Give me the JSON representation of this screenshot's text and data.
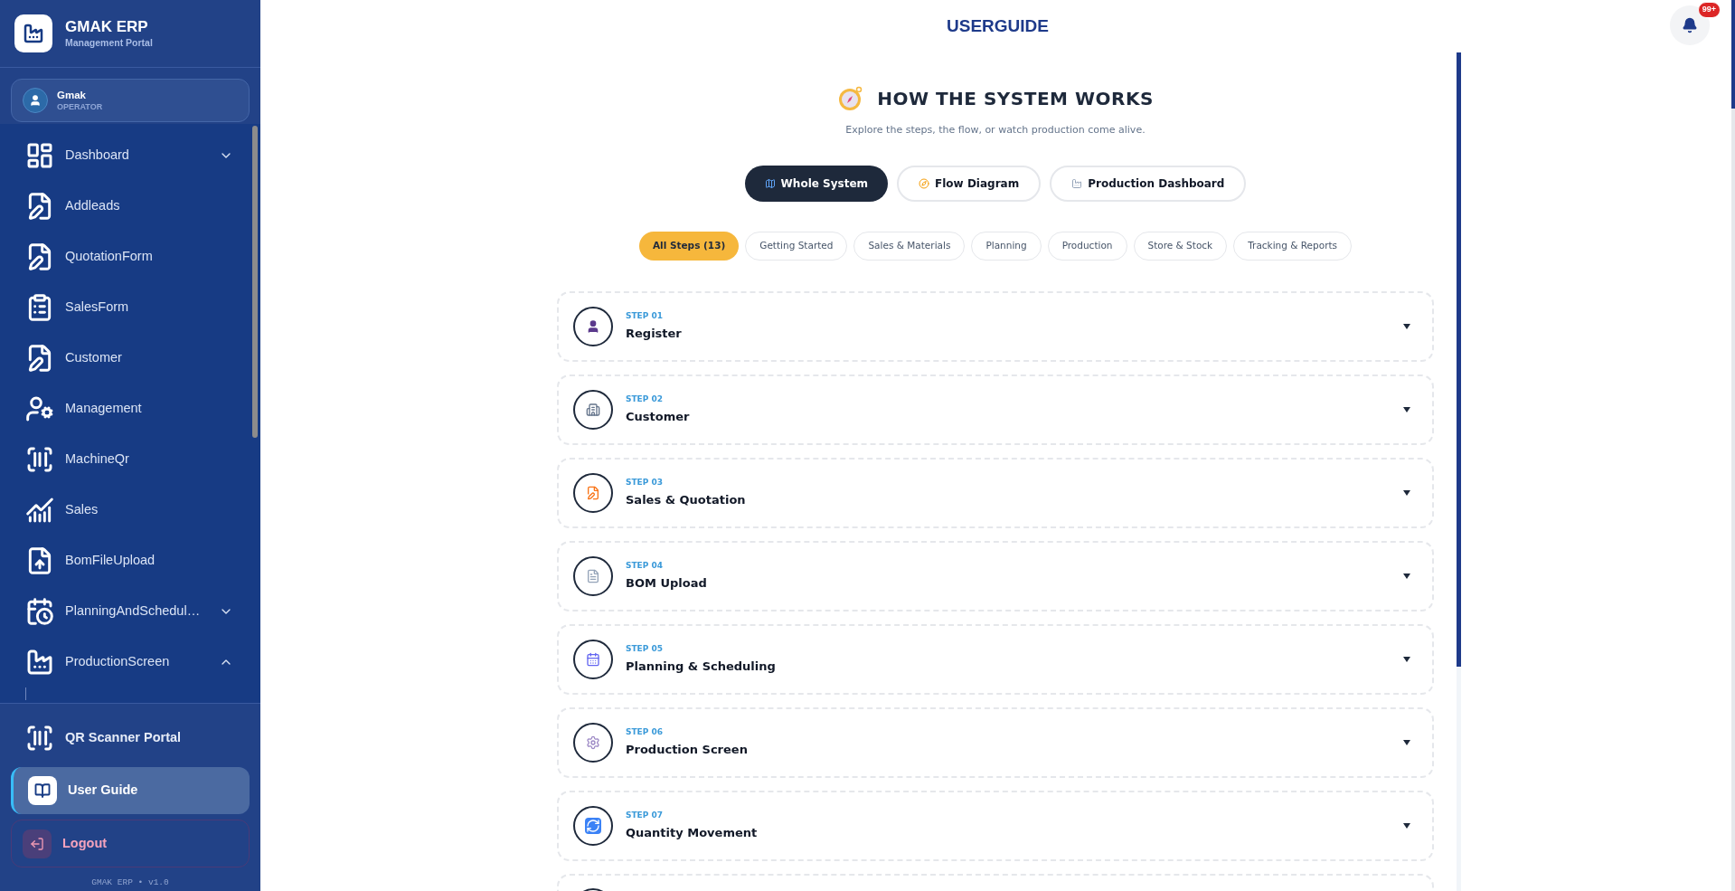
{
  "brand": {
    "title": "GMAK ERP",
    "subtitle": "Management Portal"
  },
  "user": {
    "name": "Gmak",
    "role": "OPERATOR"
  },
  "nav": [
    {
      "label": "Dashboard",
      "expanded": false
    },
    {
      "label": "Addleads"
    },
    {
      "label": "QuotationForm"
    },
    {
      "label": "SalesForm"
    },
    {
      "label": "Customer"
    },
    {
      "label": "Management"
    },
    {
      "label": "MachineQr"
    },
    {
      "label": "Sales"
    },
    {
      "label": "BomFileUpload"
    },
    {
      "label": "PlanningAndSchedul…",
      "expanded": false
    },
    {
      "label": "ProductionScreen",
      "expanded": true
    }
  ],
  "bottom_nav": [
    {
      "label": "QR Scanner Portal",
      "selected": false
    },
    {
      "label": "User Guide",
      "selected": true
    }
  ],
  "logout": "Logout",
  "version": "GMAK ERP • v1.0",
  "header": {
    "title": "USERGUIDE",
    "notifications": "99+"
  },
  "guide": {
    "title": "HOW THE SYSTEM WORKS",
    "subtitle": "Explore the steps, the flow, or watch production come alive.",
    "views": [
      {
        "label": "Whole System",
        "selected": true
      },
      {
        "label": "Flow Diagram",
        "selected": false
      },
      {
        "label": "Production Dashboard",
        "selected": false
      }
    ],
    "filters": [
      {
        "label": "All Steps (13)",
        "selected": true
      },
      {
        "label": "Getting Started",
        "selected": false
      },
      {
        "label": "Sales & Materials",
        "selected": false
      },
      {
        "label": "Planning",
        "selected": false
      },
      {
        "label": "Production",
        "selected": false
      },
      {
        "label": "Store & Stock",
        "selected": false
      },
      {
        "label": "Tracking & Reports",
        "selected": false
      }
    ],
    "steps": [
      {
        "step": "STEP 01",
        "title": "Register",
        "expanded": false
      },
      {
        "step": "STEP 02",
        "title": "Customer",
        "expanded": false
      },
      {
        "step": "STEP 03",
        "title": "Sales & Quotation",
        "expanded": false
      },
      {
        "step": "STEP 04",
        "title": "BOM Upload",
        "expanded": false
      },
      {
        "step": "STEP 05",
        "title": "Planning & Scheduling",
        "expanded": false
      },
      {
        "step": "STEP 06",
        "title": "Production Screen",
        "expanded": false
      },
      {
        "step": "STEP 07",
        "title": "Quantity Movement",
        "expanded": false
      }
    ]
  }
}
